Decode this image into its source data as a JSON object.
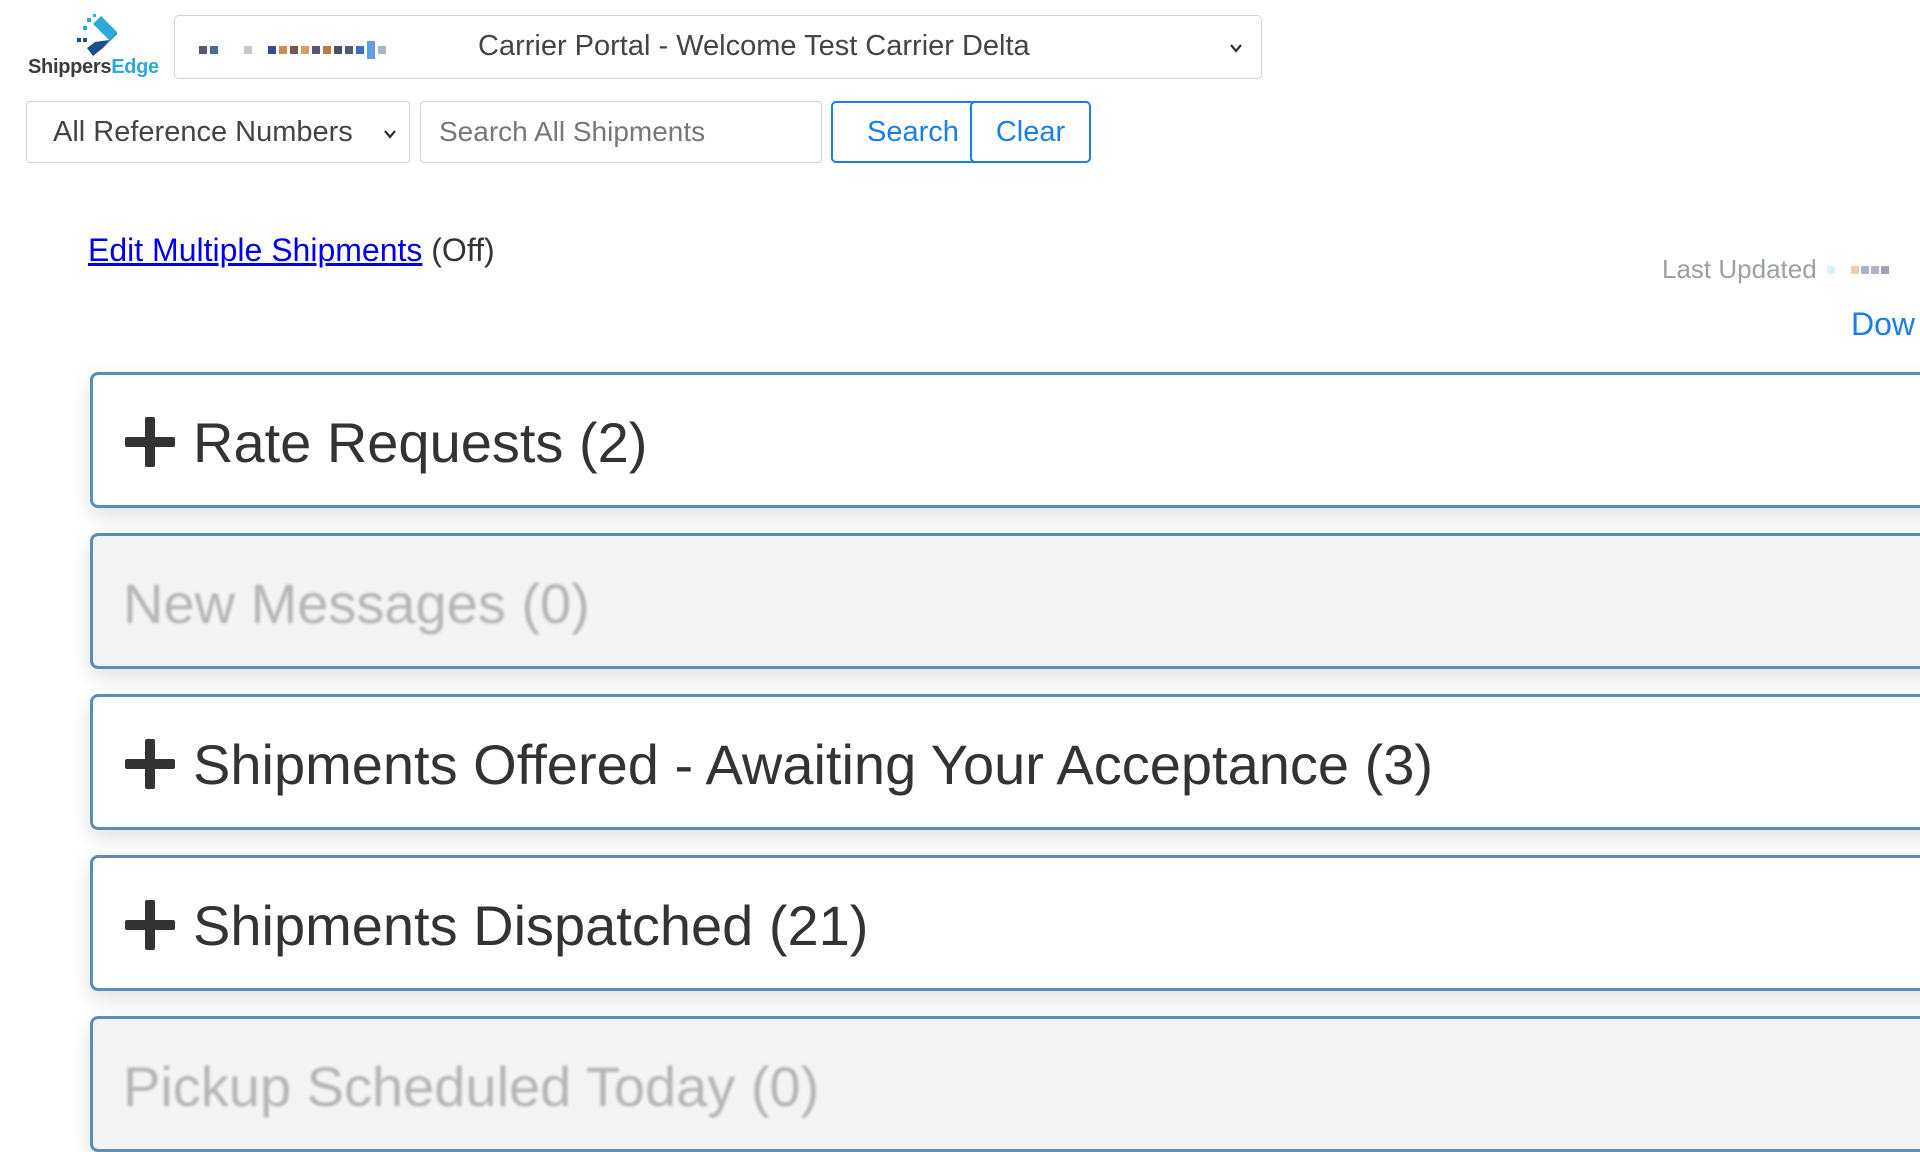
{
  "logo": {
    "word_a": "Shippers",
    "word_b": "Edge",
    "brand_color": "#2ea8d8"
  },
  "header": {
    "portal_select_value": "Carrier Portal - Welcome Test Carrier Delta"
  },
  "search_bar": {
    "reference_select_value": "All Reference Numbers",
    "search_placeholder": "Search All Shipments",
    "search_value": "",
    "search_button": "Search",
    "clear_button": "Clear"
  },
  "edit_multiple": {
    "link_label": "Edit Multiple Shipments",
    "state": "(Off)"
  },
  "status": {
    "last_updated_label": "Last Updated",
    "download_label": "Dow"
  },
  "panels": [
    {
      "title": "Rate Requests (2)",
      "expandable": true
    },
    {
      "title": "New Messages (0)",
      "expandable": false
    },
    {
      "title": "Shipments Offered - Awaiting Your Acceptance (3)",
      "expandable": true
    },
    {
      "title": "Shipments Dispatched (21)",
      "expandable": true
    },
    {
      "title": "Pickup Scheduled Today (0)",
      "expandable": false
    }
  ],
  "colors": {
    "accent": "#1a7ee8",
    "panel_border": "#5b8db8",
    "link": "#0000ee"
  }
}
